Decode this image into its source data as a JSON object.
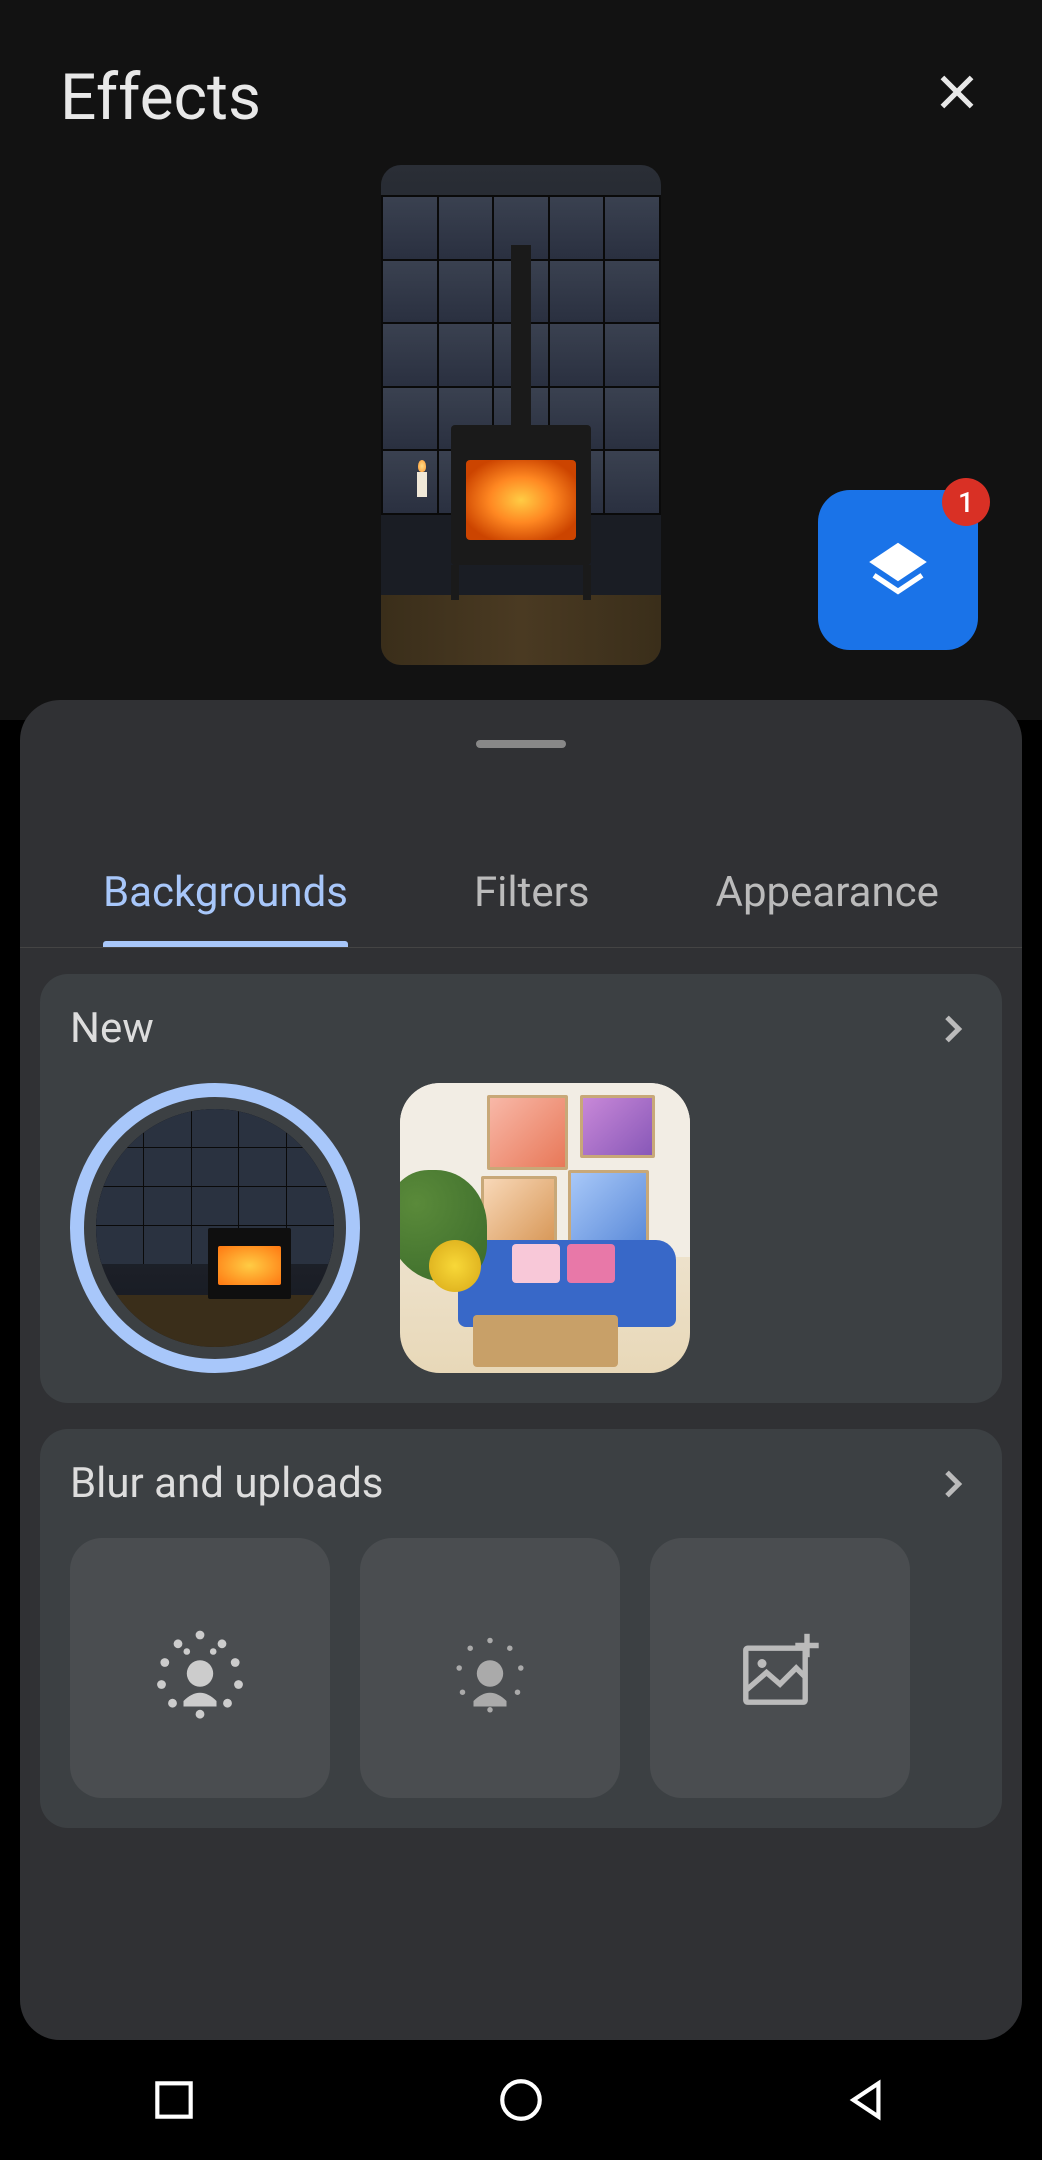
{
  "header": {
    "title": "Effects"
  },
  "layers": {
    "badge_count": "1"
  },
  "tabs": [
    {
      "id": "backgrounds",
      "label": "Backgrounds",
      "active": true
    },
    {
      "id": "filters",
      "label": "Filters",
      "active": false
    },
    {
      "id": "appearance",
      "label": "Appearance",
      "active": false
    }
  ],
  "sections": {
    "new": {
      "title": "New",
      "options": [
        {
          "id": "fireplace-window",
          "name": "Fireplace by window",
          "selected": true
        },
        {
          "id": "living-room-art",
          "name": "Living room with art",
          "selected": false
        }
      ]
    },
    "blur": {
      "title": "Blur and uploads",
      "options": [
        {
          "id": "blur-strong",
          "name": "Strong blur"
        },
        {
          "id": "blur-light",
          "name": "Light blur"
        },
        {
          "id": "upload",
          "name": "Upload image"
        }
      ]
    }
  },
  "colors": {
    "accent": "#a8c7fa",
    "primary_button": "#1a73e8",
    "badge": "#d93025",
    "panel": "#303134",
    "section": "#3c4043"
  }
}
